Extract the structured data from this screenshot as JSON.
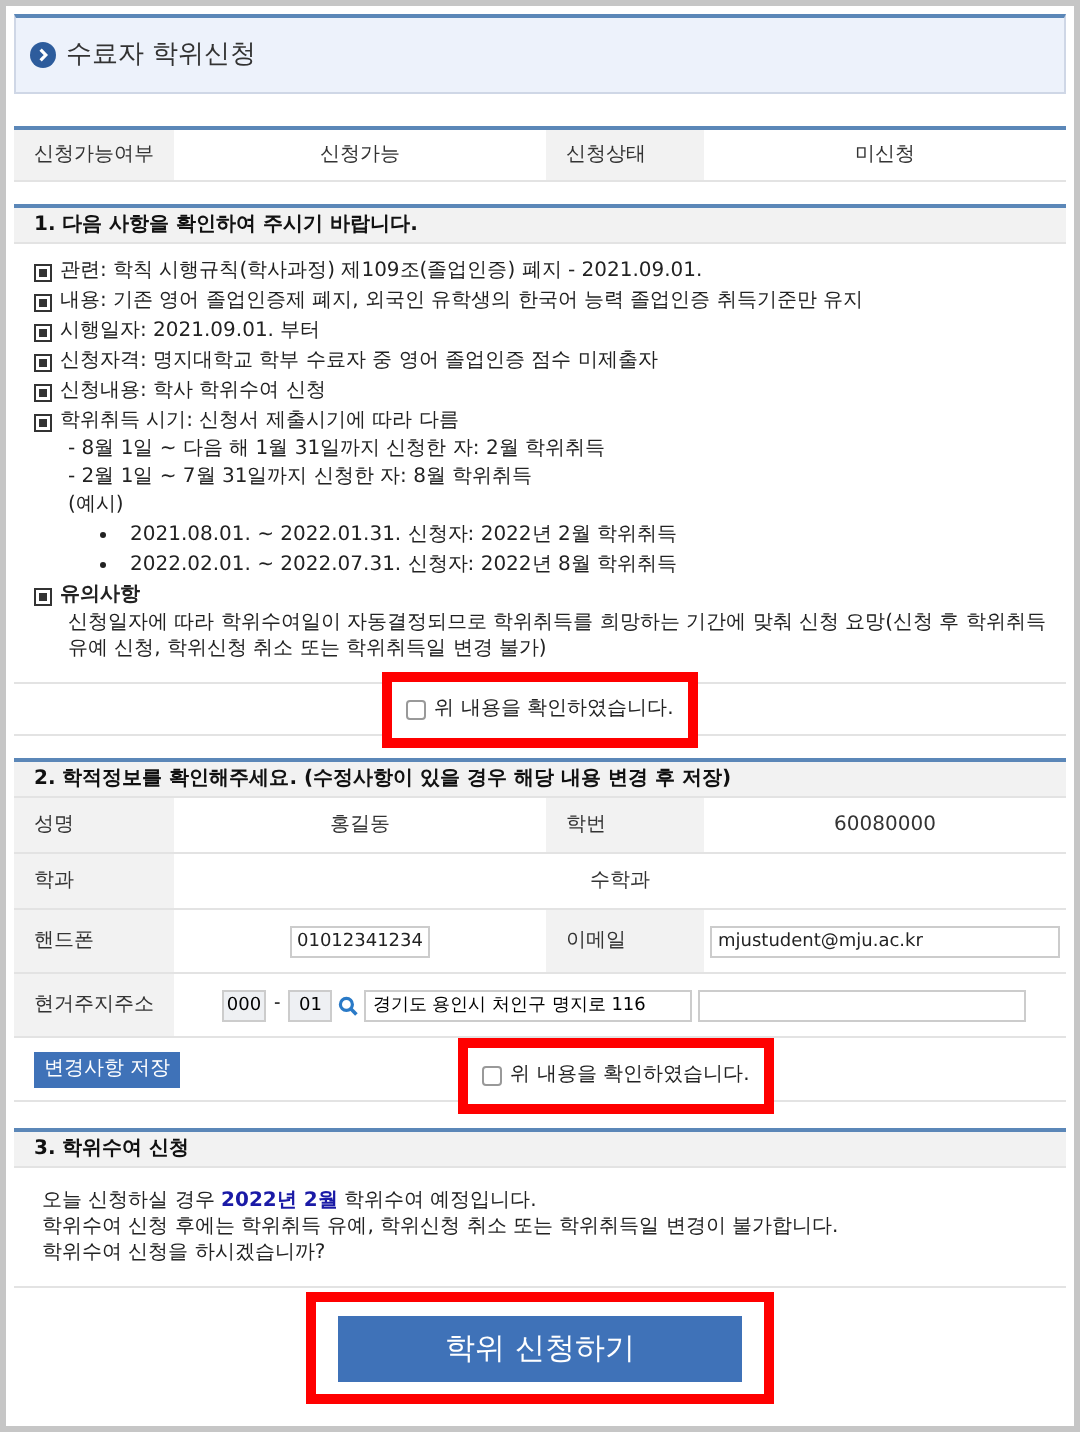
{
  "page_title": "수료자 학위신청",
  "status": {
    "available_label": "신청가능여부",
    "available_value": "신청가능",
    "state_label": "신청상태",
    "state_value": "미신청"
  },
  "section1": {
    "title": "1. 다음 사항을 확인하여 주시기 바랍니다.",
    "items": [
      {
        "text": "관련: 학칙 시행규칙(학사과정) 제109조(졸업인증) 폐지 - 2021.09.01."
      },
      {
        "text": "내용: 기존 영어 졸업인증제 폐지, 외국인 유학생의 한국어 능력 졸업인증 취득기준만 유지"
      },
      {
        "text": "시행일자: 2021.09.01. 부터"
      },
      {
        "text": "신청자격: 명지대학교 학부 수료자 중 영어 졸업인증 점수 미제출자"
      },
      {
        "text": "신청내용: 학사 학위수여 신청"
      },
      {
        "text": "학위취득 시기: 신청서 제출시기에 따라 다름",
        "lines": [
          "- 8월 1일 ~ 다음 해 1월 31일까지 신청한 자: 2월 학위취득",
          "- 2월 1일 ~ 7월 31일까지 신청한 자: 8월 학위취득",
          "(예시)"
        ],
        "examples": [
          "2021.08.01. ~ 2022.01.31. 신청자: 2022년 2월 학위취득",
          "2022.02.01. ~ 2022.07.31. 신청자: 2022년 8월 학위취득"
        ]
      }
    ],
    "caution": {
      "title": "유의사항",
      "text": "신청일자에 따라 학위수여일이 자동결정되므로 학위취득를 희망하는 기간에 맞춰 신청 요망(신청 후 학위취득 유예 신청, 학위신청 취소 또는 학위취득일 변경 불가)"
    },
    "confirm": {
      "label": "위 내용을 확인하였습니다.",
      "checked": false
    }
  },
  "section2": {
    "title": "2. 학적정보를 확인해주세요. (수정사항이 있을 경우 해당 내용 변경 후 저장)",
    "name_label": "성명",
    "name_value": "홍길동",
    "id_label": "학번",
    "id_value": "60080000",
    "dept_label": "학과",
    "dept_value": "수학과",
    "phone_label": "핸드폰",
    "phone_value": "01012341234",
    "email_label": "이메일",
    "email_value": "mjustudent@mju.ac.kr",
    "address_label": "현거주지주소",
    "zip1": "000",
    "zip_dash": "-",
    "zip2": "01",
    "address1": "경기도 용인시 처인구 명지로 116",
    "save_button": "변경사항 저장",
    "confirm": {
      "label": "위 내용을 확인하였습니다.",
      "checked": false
    }
  },
  "section3": {
    "title": "3. 학위수여 신청",
    "lines": [
      "오늘 신청하실 경우 **2022년 2월** 학위수여 예정입니다.",
      "학위수여 신청 후에는 학위취득 유예, 학위신청 취소 또는 학위취득일 변경이 불가합니다.",
      "학위수여 신청을 하시겠습니까?"
    ],
    "submit_button": "학위 신청하기"
  }
}
